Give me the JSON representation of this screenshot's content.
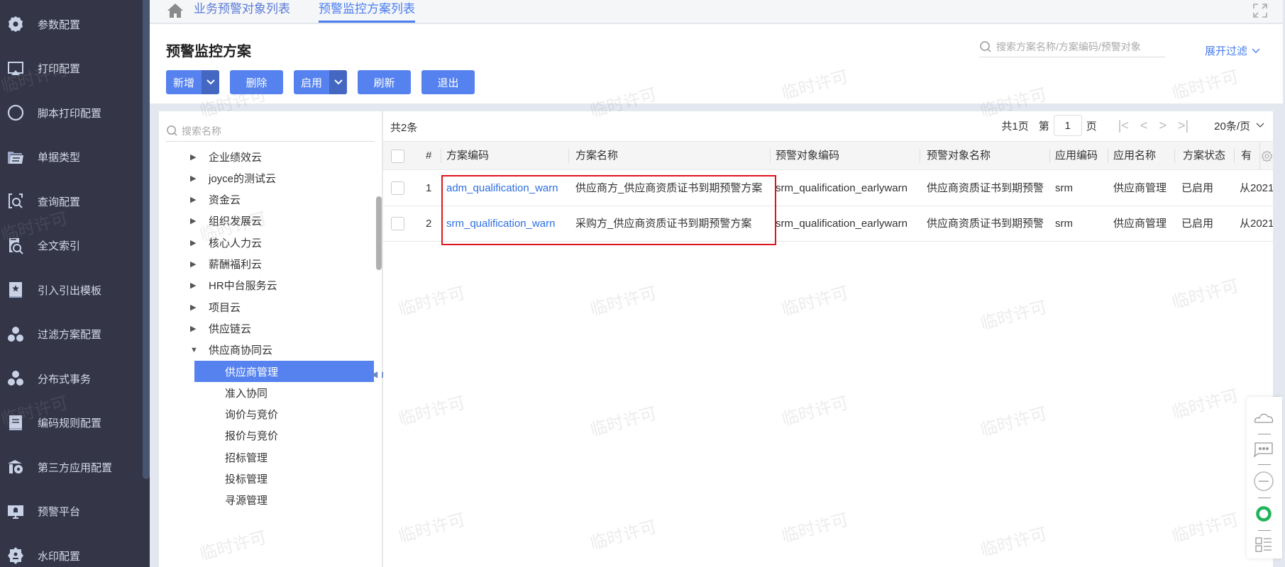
{
  "sidebar": {
    "items": [
      {
        "label": "参数配置",
        "icon": "gear-icon"
      },
      {
        "label": "打印配置",
        "icon": "print-icon"
      },
      {
        "label": "脚本打印配置",
        "icon": "circle-icon"
      },
      {
        "label": "单据类型",
        "icon": "folder-icon"
      },
      {
        "label": "查询配置",
        "icon": "query-icon"
      },
      {
        "label": "全文索引",
        "icon": "doc-search-icon"
      },
      {
        "label": "引入引出模板",
        "icon": "template-icon"
      },
      {
        "label": "过滤方案配置",
        "icon": "cluster-icon"
      },
      {
        "label": "分布式事务",
        "icon": "cluster-icon"
      },
      {
        "label": "编码规则配置",
        "icon": "book-icon"
      },
      {
        "label": "第三方应用配置",
        "icon": "third-party-icon"
      },
      {
        "label": "预警平台",
        "icon": "monitor-icon"
      },
      {
        "label": "水印配置",
        "icon": "badge-icon"
      }
    ]
  },
  "tabs": [
    {
      "label": "业务预警对象列表",
      "active": false
    },
    {
      "label": "预警监控方案列表",
      "active": true
    }
  ],
  "page": {
    "title": "预警监控方案",
    "buttons": {
      "add": "新增",
      "delete": "删除",
      "enable": "启用",
      "refresh": "刷新",
      "exit": "退出"
    },
    "search_placeholder": "搜索方案名称/方案编码/预警对象",
    "expand_filter": "展开过滤"
  },
  "tree": {
    "search_placeholder": "搜索名称",
    "nodes": [
      {
        "label": "企业绩效云",
        "level": 0,
        "expanded": false
      },
      {
        "label": "joyce的测试云",
        "level": 0,
        "expanded": false
      },
      {
        "label": "资金云",
        "level": 0,
        "expanded": false
      },
      {
        "label": "组织发展云",
        "level": 0,
        "expanded": false
      },
      {
        "label": "核心人力云",
        "level": 0,
        "expanded": false
      },
      {
        "label": "薪酬福利云",
        "level": 0,
        "expanded": false
      },
      {
        "label": "HR中台服务云",
        "level": 0,
        "expanded": false
      },
      {
        "label": "项目云",
        "level": 0,
        "expanded": false
      },
      {
        "label": "供应链云",
        "level": 0,
        "expanded": false
      },
      {
        "label": "供应商协同云",
        "level": 0,
        "expanded": true
      },
      {
        "label": "供应商管理",
        "level": 1,
        "selected": true
      },
      {
        "label": "准入协同",
        "level": 1
      },
      {
        "label": "询价与竞价",
        "level": 1
      },
      {
        "label": "报价与竞价",
        "level": 1
      },
      {
        "label": "招标管理",
        "level": 1
      },
      {
        "label": "投标管理",
        "level": 1
      },
      {
        "label": "寻源管理",
        "level": 1
      }
    ]
  },
  "table": {
    "total": "共2条",
    "pager": {
      "total_pages": "共1页",
      "page_prefix": "第",
      "page_value": "1",
      "page_suffix": "页",
      "page_size": "20条/页"
    },
    "columns": [
      "#",
      "方案编码",
      "方案名称",
      "预警对象编码",
      "预警对象名称",
      "应用编码",
      "应用名称",
      "方案状态",
      "有"
    ],
    "rows": [
      {
        "index": "1",
        "code": "adm_qualification_warn",
        "name": "供应商方_供应商资质证书到期预警方案",
        "object_code": "srm_qualification_earlywarn",
        "object_name": "供应商资质证书到期预警",
        "app_code": "srm",
        "app_name": "供应商管理",
        "status": "已启用",
        "validity": "从2021"
      },
      {
        "index": "2",
        "code": "srm_qualification_warn",
        "name": "采购方_供应商资质证书到期预警方案",
        "object_code": "srm_qualification_earlywarn",
        "object_name": "供应商资质证书到期预警",
        "app_code": "srm",
        "app_name": "供应商管理",
        "status": "已启用",
        "validity": "从2021"
      }
    ]
  },
  "watermark": "临时许可",
  "colors": {
    "primary": "#5582ef",
    "primary_dark": "#4467c1",
    "sidebar_bg": "#343647",
    "link": "#2d6ee0",
    "highlight": "#e0141e",
    "status_green": "#1fb35a"
  }
}
